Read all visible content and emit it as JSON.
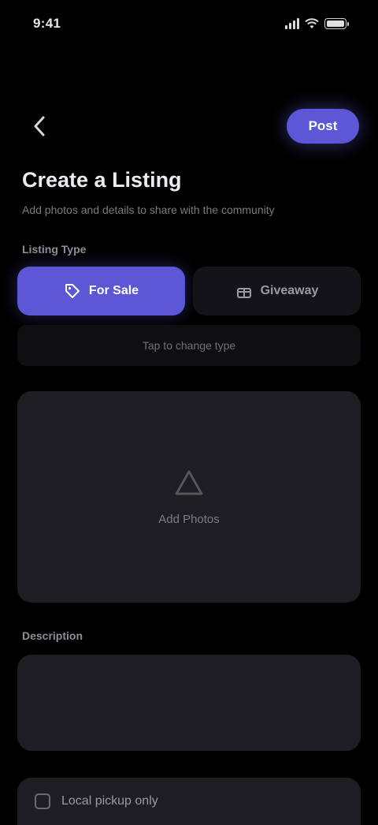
{
  "status_bar": {
    "time": "9:41"
  },
  "nav": {
    "save_label": "Post"
  },
  "header": {
    "title": "Create a Listing",
    "subtitle": "Add photos and details to share with the community"
  },
  "listing_type": {
    "label": "Listing Type",
    "options": [
      {
        "label": "For Sale",
        "icon": "tag-icon",
        "active": true
      },
      {
        "label": "Giveaway",
        "icon": "gift-icon",
        "active": false
      }
    ]
  },
  "hint": {
    "text": "Tap to change type"
  },
  "upload": {
    "text": "Add Photos",
    "icon": "image-icon"
  },
  "description": {
    "label": "Description",
    "placeholder": ""
  },
  "options": {
    "pickup_label": "Local pickup only"
  },
  "colors": {
    "accent": "#5b57d6",
    "background": "#000000",
    "surface": "#1d1d22"
  }
}
